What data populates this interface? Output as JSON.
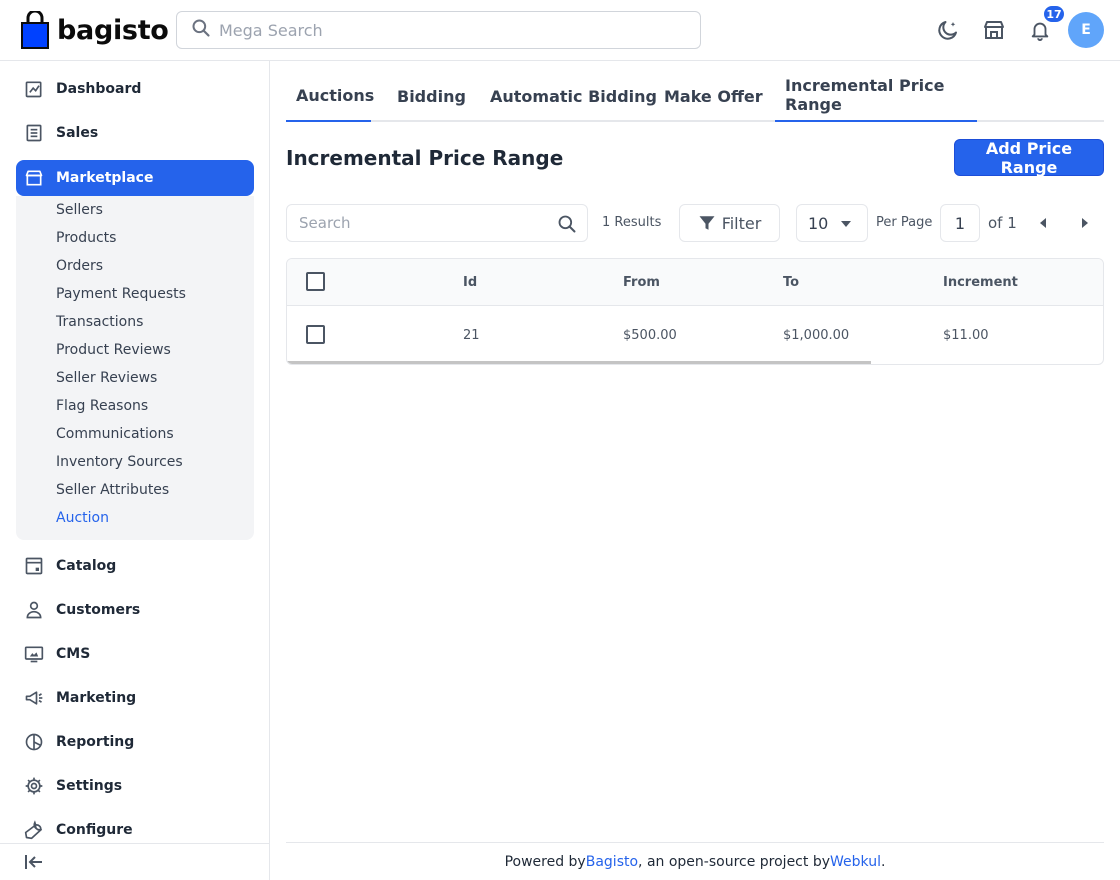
{
  "app": {
    "brand": "bagisto"
  },
  "header": {
    "search_placeholder": "Mega Search",
    "notification_count": "17",
    "avatar_initial": "E"
  },
  "sidebar": {
    "items": [
      {
        "label": "Dashboard",
        "icon": "dashboard-icon"
      },
      {
        "label": "Sales",
        "icon": "sales-icon"
      },
      {
        "label": "Marketplace",
        "icon": "store-icon",
        "active": true
      },
      {
        "label": "Catalog",
        "icon": "catalog-icon"
      },
      {
        "label": "Customers",
        "icon": "customers-icon"
      },
      {
        "label": "CMS",
        "icon": "cms-icon"
      },
      {
        "label": "Marketing",
        "icon": "megaphone-icon"
      },
      {
        "label": "Reporting",
        "icon": "reporting-icon"
      },
      {
        "label": "Settings",
        "icon": "gear-icon"
      },
      {
        "label": "Configure",
        "icon": "wrench-icon"
      }
    ],
    "submenu": [
      {
        "label": "Sellers"
      },
      {
        "label": "Products"
      },
      {
        "label": "Orders"
      },
      {
        "label": "Payment Requests"
      },
      {
        "label": "Transactions"
      },
      {
        "label": "Product Reviews"
      },
      {
        "label": "Seller Reviews"
      },
      {
        "label": "Flag Reasons"
      },
      {
        "label": "Communications"
      },
      {
        "label": "Inventory Sources"
      },
      {
        "label": "Seller Attributes"
      },
      {
        "label": "Auction",
        "active": true
      }
    ]
  },
  "tabs": [
    {
      "label": "Auctions"
    },
    {
      "label": "Bidding"
    },
    {
      "label": "Automatic Bidding"
    },
    {
      "label": "Make Offer"
    },
    {
      "label": "Incremental Price Range",
      "active": true
    }
  ],
  "page": {
    "title": "Incremental Price Range",
    "primary_button": "Add Price Range"
  },
  "toolbar": {
    "search_placeholder": "Search",
    "results": "1 Results",
    "filter_label": "Filter",
    "per_page_value": "10",
    "per_page_label": "Per Page",
    "page_number": "1",
    "page_of": "of 1"
  },
  "table": {
    "columns": [
      "Id",
      "From",
      "To",
      "Increment"
    ],
    "rows": [
      [
        "21",
        "$500.00",
        "$1,000.00",
        "$11.00"
      ]
    ]
  },
  "footer": {
    "prefix": "Powered by ",
    "link1": "Bagisto",
    "middle": ", an open-source project by ",
    "link2": "Webkul",
    "suffix": "."
  },
  "colors": {
    "accent": "#2563eb",
    "avatar": "#60a5fa"
  }
}
